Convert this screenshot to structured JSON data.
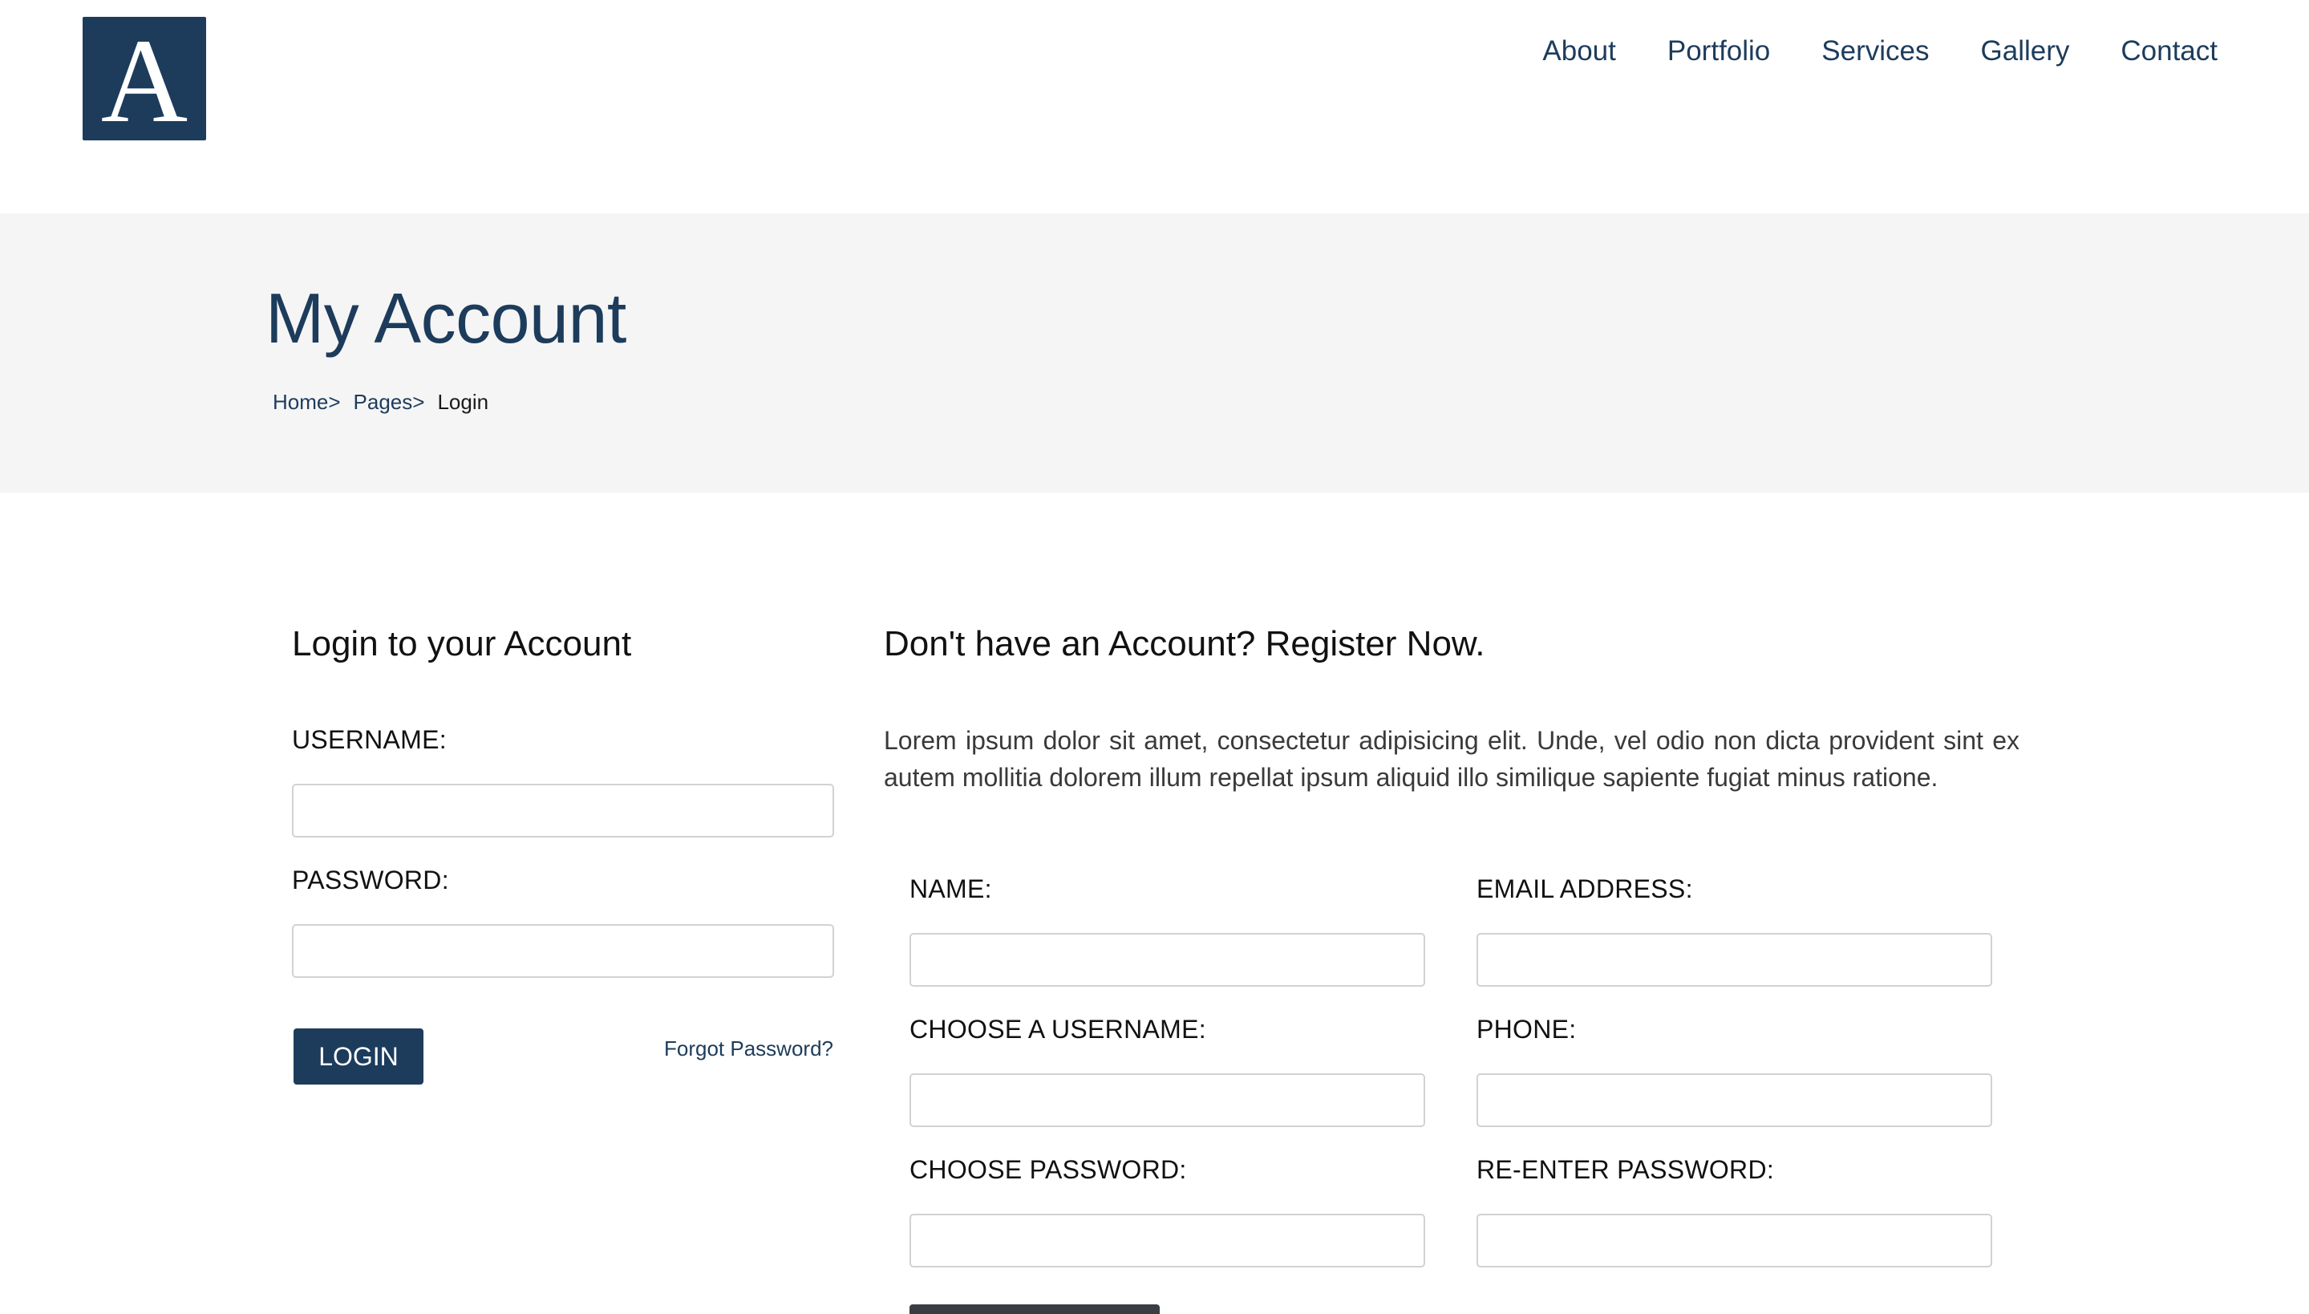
{
  "logo": {
    "letter": "A"
  },
  "nav": {
    "items": [
      {
        "label": "About"
      },
      {
        "label": "Portfolio"
      },
      {
        "label": "Services"
      },
      {
        "label": "Gallery"
      },
      {
        "label": "Contact"
      }
    ]
  },
  "banner": {
    "title": "My Account",
    "breadcrumb": {
      "home": "Home>",
      "pages": "Pages>",
      "current": "Login"
    }
  },
  "login": {
    "heading": "Login to your Account",
    "username_label": "USERNAME:",
    "username_value": "",
    "password_label": "PASSWORD:",
    "password_value": "",
    "button_label": "LOGIN",
    "forgot_label": "Forgot Password?"
  },
  "register": {
    "heading": "Don't have an Account? Register Now.",
    "intro": "Lorem ipsum dolor sit amet, consectetur adipisicing elit. Unde, vel odio non dicta provident sint ex autem mollitia dolorem illum repellat ipsum aliquid illo similique sapiente fugiat minus ratione.",
    "name_label": "NAME:",
    "email_label": "EMAIL ADDRESS:",
    "username_label": "CHOOSE A USERNAME:",
    "phone_label": "PHONE:",
    "password_label": "CHOOSE PASSWORD:",
    "reenter_label": "RE-ENTER PASSWORD:"
  },
  "colors": {
    "brand": "#1d3c5c",
    "banner_bg": "#f5f5f5",
    "input_border": "#d2d2d2"
  }
}
